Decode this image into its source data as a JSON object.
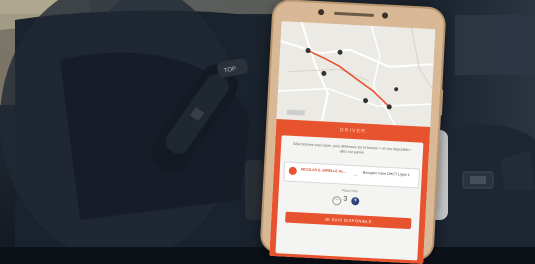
{
  "app": {
    "panel_title": "DRIVER",
    "description": "Sélectionnez votre ligne, puis définissez sur le bouton + et vos disponible • allez sur panier",
    "route": {
      "from": "NICOLAS E. DIRELLE Av...",
      "to": "Bourgoin Gare DHCT Ligne 1"
    },
    "places_label": "Place libre",
    "places_value": "3",
    "minus": "−",
    "plus": "+",
    "cta_label": "JE SUIS DISPONIBLE"
  },
  "car": {
    "gear_knob_label": "TOP"
  }
}
